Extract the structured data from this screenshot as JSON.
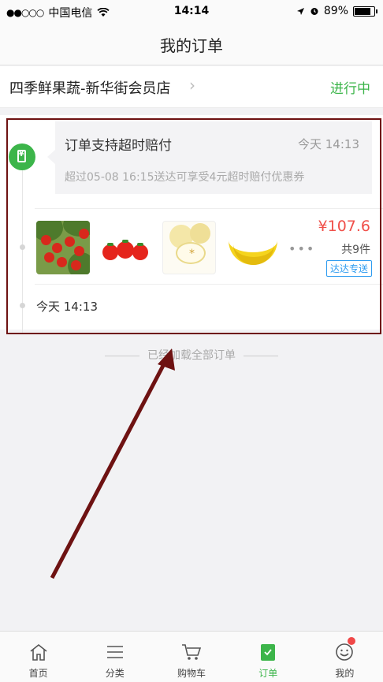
{
  "status_bar": {
    "signal": "●●○○○",
    "carrier": "中国电信",
    "time": "14:14",
    "battery": "89%",
    "battery_level": 0.89
  },
  "navbar": {
    "title": "我的订单"
  },
  "order": {
    "store_name": "四季鲜果蔬-新华街会员店",
    "status": "进行中",
    "promo": {
      "title": "订单支持超时赔付",
      "time": "今天 14:13",
      "desc": "超过05-08 16:15送达可享受4元超时赔付优惠券"
    },
    "products": [
      {
        "icon": "lychee-image"
      },
      {
        "icon": "tomato-image"
      },
      {
        "icon": "pear-image"
      },
      {
        "icon": "banana-image"
      }
    ],
    "more": "•••",
    "price": "¥107.6",
    "quantity": "共9件",
    "delivery_badge": "达达专送",
    "order_time": "今天 14:13"
  },
  "footer": {
    "loaded_text": "已经加载全部订单"
  },
  "tabs": [
    {
      "label": "首页",
      "icon": "home-icon"
    },
    {
      "label": "分类",
      "icon": "list-icon"
    },
    {
      "label": "购物车",
      "icon": "cart-icon"
    },
    {
      "label": "订单",
      "icon": "order-icon",
      "active": true
    },
    {
      "label": "我的",
      "icon": "profile-icon"
    }
  ],
  "colors": {
    "accent": "#3cb54a",
    "price": "#f0504a",
    "badge": "#2e9cf0",
    "highlight": "#6e1212"
  }
}
